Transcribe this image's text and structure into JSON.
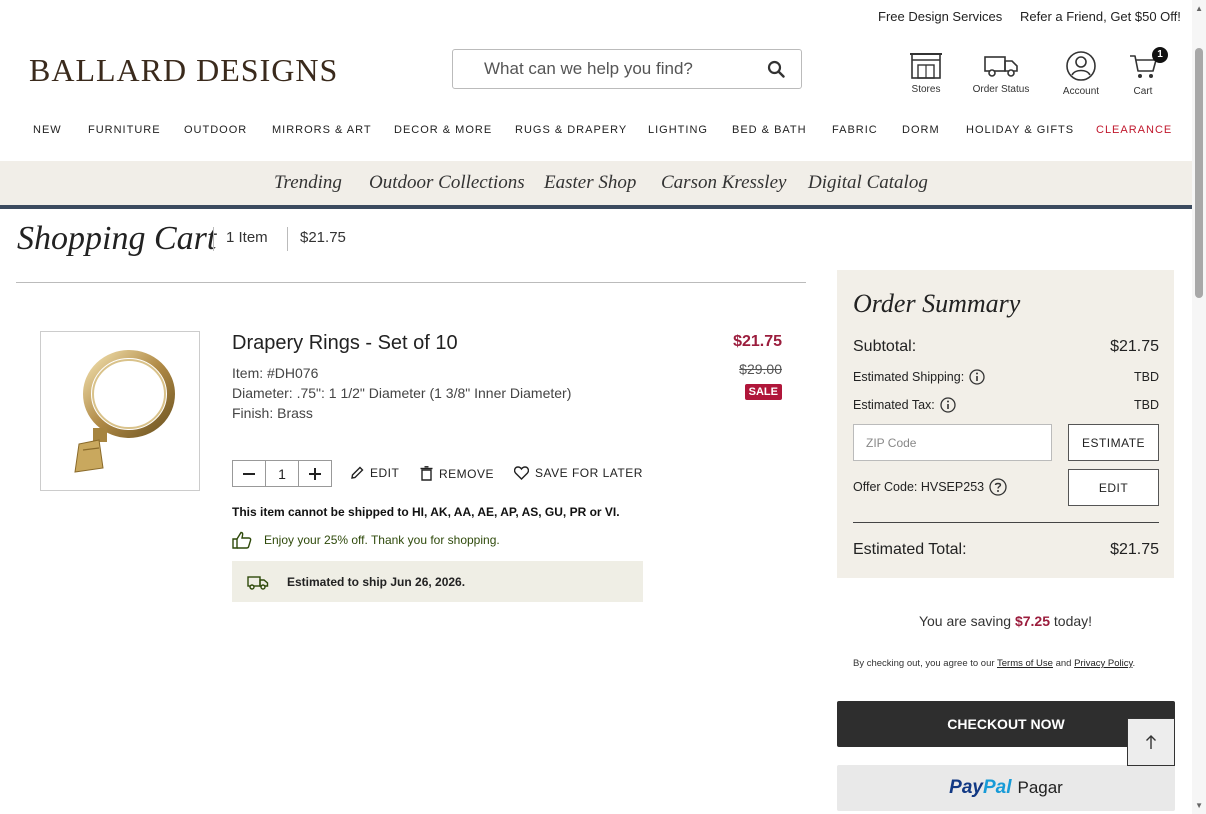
{
  "utility": {
    "design_services": "Free Design Services",
    "refer": "Refer a Friend, Get $50 Off!"
  },
  "header": {
    "logo": "BALLARD DESIGNS",
    "search_placeholder": "What can we help you find?",
    "icons": {
      "stores": "Stores",
      "order_status": "Order Status",
      "account": "Account",
      "cart": "Cart",
      "cart_count": "1"
    }
  },
  "main_nav": [
    "NEW",
    "FURNITURE",
    "OUTDOOR",
    "MIRRORS & ART",
    "DECOR & MORE",
    "RUGS & DRAPERY",
    "LIGHTING",
    "BED & BATH",
    "FABRIC",
    "DORM",
    "HOLIDAY & GIFTS",
    "CLEARANCE"
  ],
  "sub_nav": [
    "Trending",
    "Outdoor Collections",
    "Easter Shop",
    "Carson Kressley",
    "Digital Catalog"
  ],
  "cart": {
    "title": "Shopping Cart",
    "item_count": "1 Item",
    "total": "$21.75"
  },
  "product": {
    "name": "Drapery Rings - Set of 10",
    "item": "Item: #DH076",
    "diameter": "Diameter: .75\": 1 1/2\" Diameter (1 3/8\" Inner Diameter)",
    "finish": "Finish: Brass",
    "price_sale": "$21.75",
    "price_original": "$29.00",
    "sale_badge": "SALE",
    "quantity": "1",
    "actions": {
      "edit": "EDIT",
      "remove": "REMOVE",
      "save": "SAVE FOR LATER"
    },
    "ship_warning": "This item cannot be shipped to HI, AK, AA, AE, AP, AS, GU, PR or VI.",
    "promo": "Enjoy your 25% off. Thank you for shopping.",
    "ship_estimate": "Estimated to ship Jun 26, 2026."
  },
  "summary": {
    "title": "Order Summary",
    "subtotal_label": "Subtotal:",
    "subtotal_value": "$21.75",
    "shipping_label": "Estimated Shipping:",
    "shipping_value": "TBD",
    "tax_label": "Estimated Tax:",
    "tax_value": "TBD",
    "zip_placeholder": "ZIP Code",
    "estimate_button": "ESTIMATE",
    "offer_label": "Offer Code: HVSEP253",
    "edit_button": "EDIT",
    "total_label": "Estimated Total:",
    "total_value": "$21.75"
  },
  "saving": {
    "prefix": "You are saving",
    "amount": "$7.25",
    "suffix": "today!"
  },
  "legal": {
    "prefix": "By checking out, you agree to our",
    "terms": "Terms of Use",
    "and": "and",
    "privacy": "Privacy Policy"
  },
  "checkout_button": "CHECKOUT NOW",
  "paypal": {
    "logo_pay": "Pay",
    "logo_pal": "Pal",
    "label": "Pagar"
  },
  "colors": {
    "accent_sale": "#9b1d3d",
    "clearance": "#c0172c",
    "subnav_bg": "#f1eee8",
    "summary_bg": "#f2efe8",
    "checkout_bg": "#2e2e2e"
  }
}
